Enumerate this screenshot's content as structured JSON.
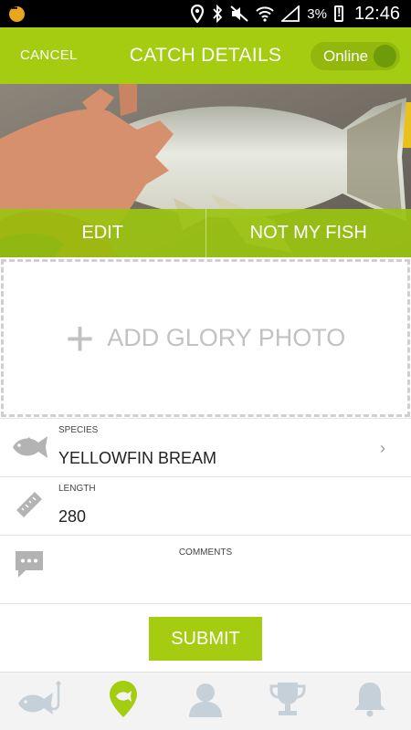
{
  "status_bar": {
    "battery": "3%",
    "time": "12:46",
    "icons": [
      "notification-dot-icon",
      "location-icon",
      "bluetooth-icon",
      "mute-icon",
      "wifi-icon",
      "signal-icon",
      "battery-icon"
    ]
  },
  "header": {
    "cancel_label": "CANCEL",
    "title": "CATCH DETAILS",
    "online_label": "Online"
  },
  "photo": {
    "edit_label": "EDIT",
    "not_my_fish_label": "NOT MY FISH"
  },
  "glory": {
    "label": "ADD GLORY PHOTO"
  },
  "form": {
    "species_label": "SPECIES",
    "species_value": "YELLOWFIN BREAM",
    "length_label": "LENGTH",
    "length_value": "280",
    "comments_label": "COMMENTS"
  },
  "submit_label": "SUBMIT",
  "nav": {
    "items": [
      "fish-hook-icon",
      "location-pin-icon",
      "profile-icon",
      "trophy-icon",
      "bell-icon"
    ],
    "active": "location-pin-icon",
    "active_color": "#a4cc10",
    "inactive_color": "#c5d0d8"
  },
  "colors": {
    "accent": "#a4cc10"
  }
}
